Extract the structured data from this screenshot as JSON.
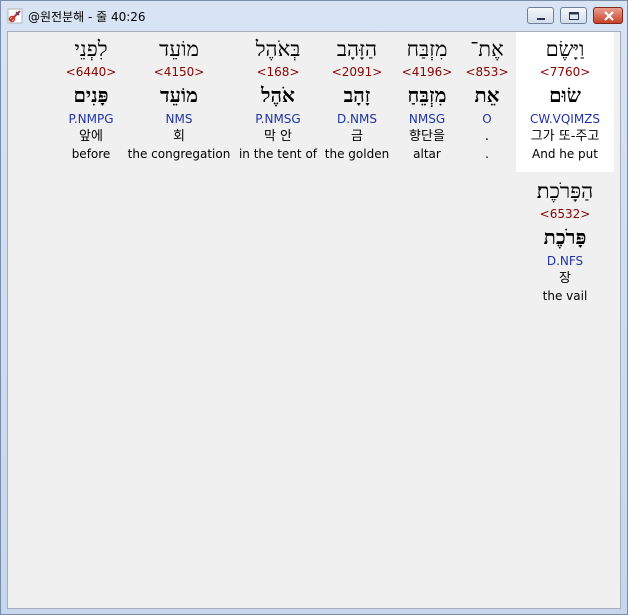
{
  "window": {
    "title": "@원전분해 - 줄 40:26"
  },
  "words": [
    {
      "heb": "וַיָּשֶׂם",
      "strong": "<7760>",
      "lemma": "שׂוּם",
      "morph": "CW.VQIMZS",
      "kor": "그가 또-주고",
      "eng": "And he put"
    },
    {
      "heb": "אֶת־",
      "strong": "<853>",
      "lemma": "אֵת",
      "morph": "O",
      "kor": ".",
      "eng": "."
    },
    {
      "heb": "מִזְבַּח",
      "strong": "<4196>",
      "lemma": "מִזְבֵּחַ",
      "morph": "NMSG",
      "kor": "향단을",
      "eng": "altar"
    },
    {
      "heb": "הַזָּהָב",
      "strong": "<2091>",
      "lemma": "זָהָב",
      "morph": "D.NMS",
      "kor": "금",
      "eng": "the golden"
    },
    {
      "heb": "בְּאֹהֶל",
      "strong": "<168>",
      "lemma": "אֹהֶל",
      "morph": "P.NMSG",
      "kor": "막 안",
      "eng": "in the tent of"
    },
    {
      "heb": "מוֹעֵד",
      "strong": "<4150>",
      "lemma": "מוֹעֵד",
      "morph": "NMS",
      "kor": "회",
      "eng": "the congregation"
    },
    {
      "heb": "לִפְנֵי",
      "strong": "<6440>",
      "lemma": "פָּנִים",
      "morph": "P.NMPG",
      "kor": "앞에",
      "eng": "before"
    },
    {
      "heb": "הַפָּרֹכֶת׃",
      "strong": "<6532>",
      "lemma": "פָּרֹכֶת",
      "morph": "D.NFS",
      "kor": "장",
      "eng": "the vail"
    }
  ]
}
